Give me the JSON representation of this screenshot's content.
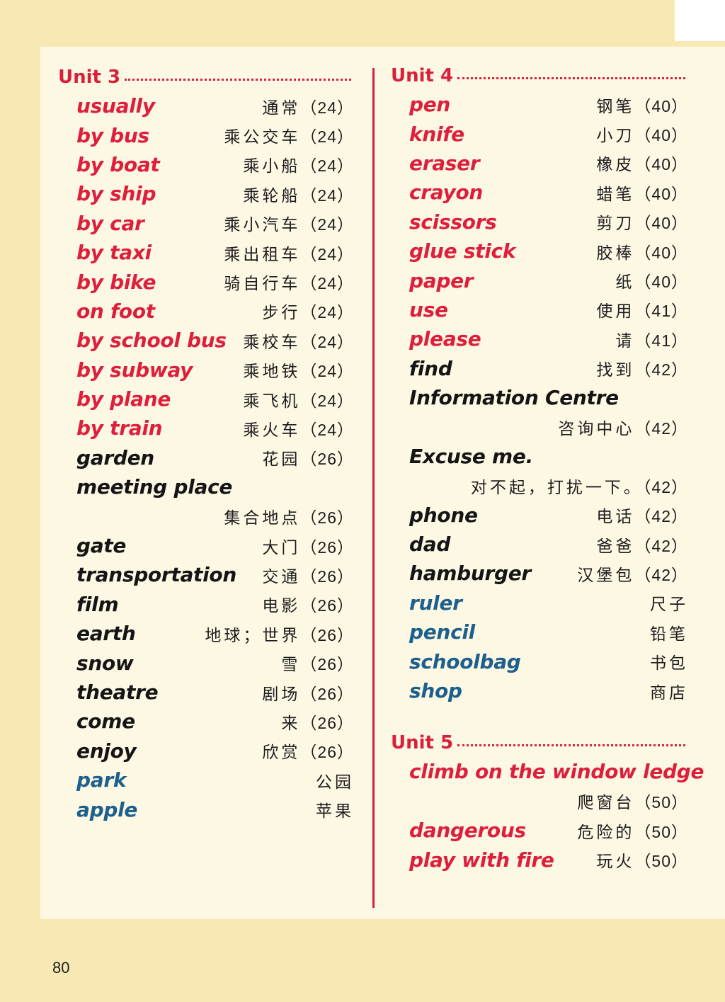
{
  "unit3": {
    "title": "Unit 3",
    "entries": [
      {
        "en": "usually",
        "cn": "通常",
        "page": "（24）",
        "color": "red"
      },
      {
        "en": "by bus",
        "cn": "乘公交车",
        "page": "（24）",
        "color": "red"
      },
      {
        "en": "by boat",
        "cn": "乘小船",
        "page": "（24）",
        "color": "red"
      },
      {
        "en": "by ship",
        "cn": "乘轮船",
        "page": "（24）",
        "color": "red"
      },
      {
        "en": "by car",
        "cn": "乘小汽车",
        "page": "（24）",
        "color": "red"
      },
      {
        "en": "by taxi",
        "cn": "乘出租车",
        "page": "（24）",
        "color": "red"
      },
      {
        "en": "by bike",
        "cn": "骑自行车",
        "page": "（24）",
        "color": "red"
      },
      {
        "en": "on foot",
        "cn": "步行",
        "page": "（24）",
        "color": "red"
      },
      {
        "en": "by school bus",
        "cn": "乘校车",
        "page": "（24）",
        "color": "red"
      },
      {
        "en": "by subway",
        "cn": "乘地铁",
        "page": "（24）",
        "color": "red"
      },
      {
        "en": "by plane",
        "cn": "乘飞机",
        "page": "（24）",
        "color": "red"
      },
      {
        "en": "by train",
        "cn": "乘火车",
        "page": "（24）",
        "color": "red"
      },
      {
        "en": "garden",
        "cn": "花园",
        "page": "（26）",
        "color": "black"
      },
      {
        "en": "meeting place",
        "cn": "",
        "page": "",
        "color": "black"
      },
      {
        "en": "",
        "cn": "集合地点",
        "page": "（26）",
        "color": "black"
      },
      {
        "en": "gate",
        "cn": "大门",
        "page": "（26）",
        "color": "black"
      },
      {
        "en": "transportation",
        "cn": "交通",
        "page": "（26）",
        "color": "black"
      },
      {
        "en": "film",
        "cn": "电影",
        "page": "（26）",
        "color": "black"
      },
      {
        "en": "earth",
        "cn": "地球；世界",
        "page": "（26）",
        "color": "black"
      },
      {
        "en": "snow",
        "cn": "雪",
        "page": "（26）",
        "color": "black"
      },
      {
        "en": "theatre",
        "cn": "剧场",
        "page": "（26）",
        "color": "black"
      },
      {
        "en": "come",
        "cn": "来",
        "page": "（26）",
        "color": "black"
      },
      {
        "en": "enjoy",
        "cn": "欣赏",
        "page": "（26）",
        "color": "black"
      },
      {
        "en": "park",
        "cn": "公园",
        "page": "",
        "color": "blue"
      },
      {
        "en": "apple",
        "cn": "苹果",
        "page": "",
        "color": "blue"
      }
    ]
  },
  "unit4": {
    "title": "Unit 4",
    "entries": [
      {
        "en": "pen",
        "cn": "钢笔",
        "page": "（40）",
        "color": "red"
      },
      {
        "en": "knife",
        "cn": "小刀",
        "page": "（40）",
        "color": "red"
      },
      {
        "en": "eraser",
        "cn": "橡皮",
        "page": "（40）",
        "color": "red"
      },
      {
        "en": "crayon",
        "cn": "蜡笔",
        "page": "（40）",
        "color": "red"
      },
      {
        "en": "scissors",
        "cn": "剪刀",
        "page": "（40）",
        "color": "red"
      },
      {
        "en": "glue stick",
        "cn": "胶棒",
        "page": "（40）",
        "color": "red"
      },
      {
        "en": "paper",
        "cn": "纸",
        "page": "（40）",
        "color": "red"
      },
      {
        "en": "use",
        "cn": "使用",
        "page": "（41）",
        "color": "red"
      },
      {
        "en": "please",
        "cn": "请",
        "page": "（41）",
        "color": "red"
      },
      {
        "en": "find",
        "cn": "找到",
        "page": "（42）",
        "color": "black"
      },
      {
        "en": "Information Centre",
        "cn": "",
        "page": "",
        "color": "black"
      },
      {
        "en": "",
        "cn": "咨询中心",
        "page": "（42）",
        "color": "black"
      },
      {
        "en": "Excuse me.",
        "cn": "",
        "page": "",
        "color": "black"
      },
      {
        "en": "",
        "cn": "对不起，打扰一下。",
        "page": "（42）",
        "color": "black"
      },
      {
        "en": "phone",
        "cn": "电话",
        "page": "（42）",
        "color": "black"
      },
      {
        "en": "dad",
        "cn": "爸爸",
        "page": "（42）",
        "color": "black"
      },
      {
        "en": "hamburger",
        "cn": "汉堡包",
        "page": "（42）",
        "color": "black"
      },
      {
        "en": "ruler",
        "cn": "尺子",
        "page": "",
        "color": "blue"
      },
      {
        "en": "pencil",
        "cn": "铅笔",
        "page": "",
        "color": "blue"
      },
      {
        "en": "schoolbag",
        "cn": "书包",
        "page": "",
        "color": "blue"
      },
      {
        "en": "shop",
        "cn": "商店",
        "page": "",
        "color": "blue"
      }
    ]
  },
  "unit5": {
    "title": "Unit 5",
    "entries": [
      {
        "en": "climb on the window ledge",
        "cn": "",
        "page": "",
        "color": "red"
      },
      {
        "en": "",
        "cn": "爬窗台",
        "page": "（50）",
        "color": "red"
      },
      {
        "en": "dangerous",
        "cn": "危险的",
        "page": "（50）",
        "color": "red"
      },
      {
        "en": "play with fire",
        "cn": "玩火",
        "page": "（50）",
        "color": "red"
      }
    ]
  },
  "page_number": "80",
  "colors": {
    "red": "#de1f3c",
    "black": "#151515",
    "blue": "#1d5f8d",
    "background": "#f8e9b4",
    "panel": "#fcf8e4"
  }
}
